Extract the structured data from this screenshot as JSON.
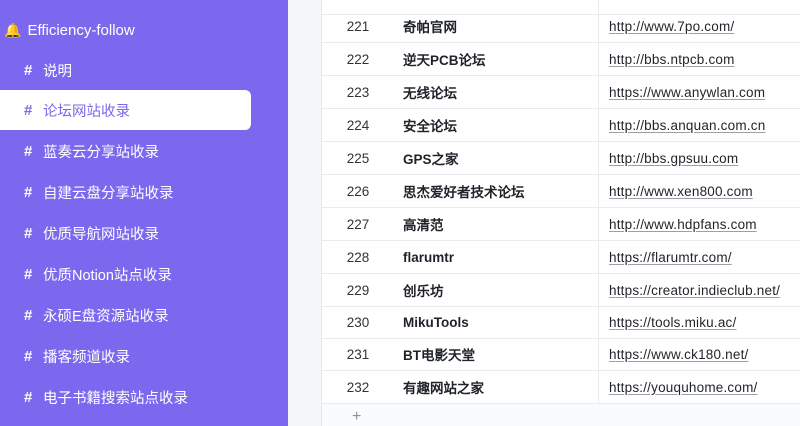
{
  "sidebar": {
    "workspace_title": "Efficiency-follow",
    "workspace_icon": "bell-icon",
    "accent_color": "#7b68ee",
    "items": [
      {
        "label": "说明",
        "active": false
      },
      {
        "label": "论坛网站收录",
        "active": true
      },
      {
        "label": "蓝奏云分享站收录",
        "active": false
      },
      {
        "label": "自建云盘分享站收录",
        "active": false
      },
      {
        "label": "优质导航网站收录",
        "active": false
      },
      {
        "label": "优质Notion站点收录",
        "active": false
      },
      {
        "label": "永硕E盘资源站收录",
        "active": false
      },
      {
        "label": "播客频道收录",
        "active": false
      },
      {
        "label": "电子书籍搜索站点收录",
        "active": false
      }
    ]
  },
  "table": {
    "rows": [
      {
        "id": "221",
        "name": "奇帕官网",
        "url": "http://www.7po.com/"
      },
      {
        "id": "222",
        "name": "逆天PCB论坛",
        "url": "http://bbs.ntpcb.com"
      },
      {
        "id": "223",
        "name": "无线论坛",
        "url": "https://www.anywlan.com"
      },
      {
        "id": "224",
        "name": "安全论坛",
        "url": "http://bbs.anquan.com.cn"
      },
      {
        "id": "225",
        "name": "GPS之家",
        "url": "http://bbs.gpsuu.com"
      },
      {
        "id": "226",
        "name": "思杰爱好者技术论坛",
        "url": "http://www.xen800.com"
      },
      {
        "id": "227",
        "name": "高清范",
        "url": "http://www.hdpfans.com"
      },
      {
        "id": "228",
        "name": "flarumtr",
        "url": "https://flarumtr.com/"
      },
      {
        "id": "229",
        "name": "创乐坊",
        "url": "https://creator.indieclub.net/"
      },
      {
        "id": "230",
        "name": "MikuTools",
        "url": "https://tools.miku.ac/"
      },
      {
        "id": "231",
        "name": "BT电影天堂",
        "url": "https://www.ck180.net/"
      },
      {
        "id": "232",
        "name": "有趣网站之家",
        "url": "https://youquhome.com/"
      }
    ],
    "add_label": "+"
  }
}
